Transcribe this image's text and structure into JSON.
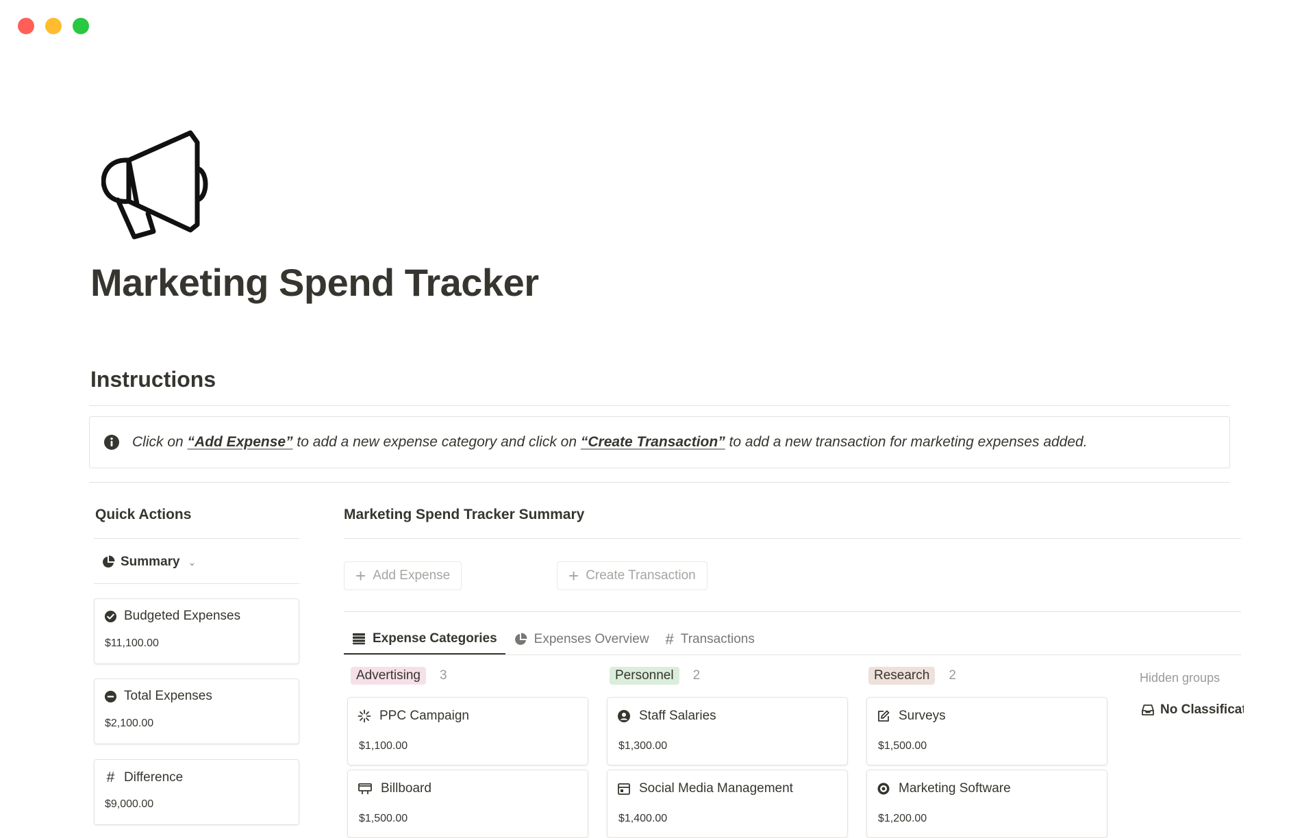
{
  "page": {
    "title": "Marketing Spend Tracker",
    "icon": "megaphone-icon"
  },
  "instructions": {
    "heading": "Instructions",
    "callout": {
      "icon": "info-icon",
      "part1": "Click on ",
      "link1": "“Add Expense”",
      "part2": " to add a new expense category and click on ",
      "link2": "“Create Transaction”",
      "part3": " to add a new transaction for marketing expenses added."
    }
  },
  "quick_actions": {
    "title": "Quick Actions",
    "toggle_label": "Summary",
    "stats": [
      {
        "label": "Budgeted Expenses",
        "value": "$11,100.00",
        "icon": "check-circle-icon"
      },
      {
        "label": "Total Expenses",
        "value": "$2,100.00",
        "icon": "minus-circle-icon"
      },
      {
        "label": "Difference",
        "value": "$9,000.00",
        "icon": "hash-icon"
      }
    ]
  },
  "summary": {
    "title": "Marketing Spend Tracker Summary",
    "buttons": {
      "add_expense": "Add Expense",
      "create_transaction": "Create Transaction"
    },
    "tabs": [
      {
        "label": "Expense Categories",
        "icon": "table-icon",
        "active": true
      },
      {
        "label": "Expenses Overview",
        "icon": "pie-chart-icon",
        "active": false
      },
      {
        "label": "Transactions",
        "icon": "hash-icon",
        "active": false
      }
    ],
    "groups": [
      {
        "tag": "Advertising",
        "tag_color": "#f5e0e9",
        "count": "3",
        "cards": [
          {
            "name": "PPC Campaign",
            "amount": "$1,100.00",
            "icon": "loading-spinner-icon"
          },
          {
            "name": "Billboard",
            "amount": "$1,500.00",
            "icon": "billboard-icon"
          }
        ]
      },
      {
        "tag": "Personnel",
        "tag_color": "#dbeddb",
        "count": "2",
        "cards": [
          {
            "name": "Staff Salaries",
            "amount": "$1,300.00",
            "icon": "user-circle-icon"
          },
          {
            "name": "Social Media Management",
            "amount": "$1,400.00",
            "icon": "calendar-icon"
          }
        ]
      },
      {
        "tag": "Research",
        "tag_color": "#eee0da",
        "count": "2",
        "cards": [
          {
            "name": "Surveys",
            "amount": "$1,500.00",
            "icon": "edit-icon"
          },
          {
            "name": "Marketing Software",
            "amount": "$1,200.00",
            "icon": "target-icon"
          }
        ]
      }
    ],
    "hidden_groups_label": "Hidden groups",
    "hidden_group": "No Classification"
  }
}
